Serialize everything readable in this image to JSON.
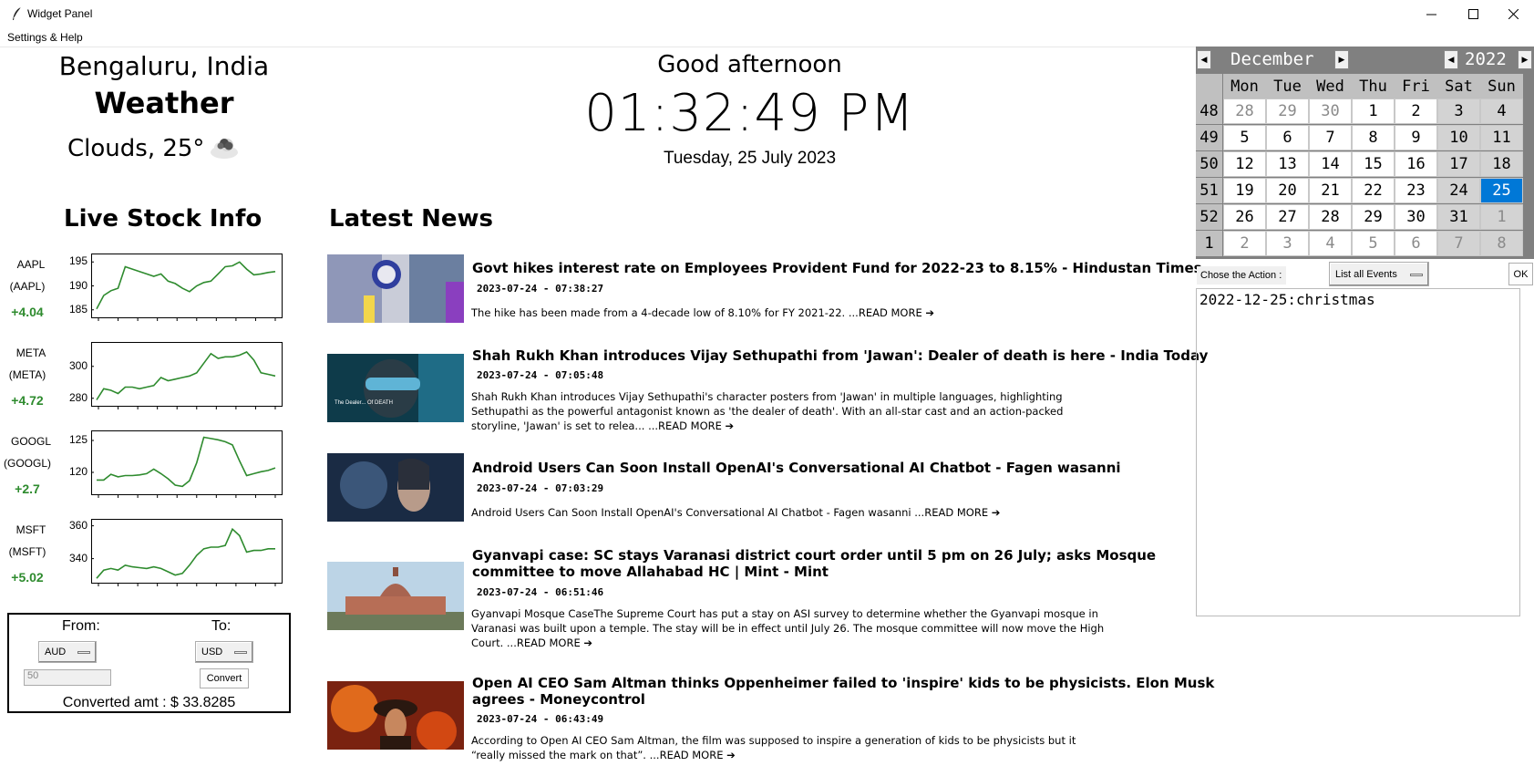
{
  "window": {
    "title": "Widget Panel",
    "controls": {
      "minimize": "minimize-icon",
      "maximize": "maximize-icon",
      "close": "close-icon"
    }
  },
  "menu": {
    "settings_help": "Settings & Help"
  },
  "weather": {
    "city": "Bengaluru, India",
    "title": "Weather",
    "condition": "Clouds, 25°",
    "icon": "cloud-icon"
  },
  "clock": {
    "greeting": "Good afternoon",
    "time": "01:32:49 PM",
    "date": "Tuesday, 25 July 2023"
  },
  "stocks": {
    "title": "Live Stock Info",
    "items": [
      {
        "symbol": "AAPL",
        "symbol2": "(AAPL)",
        "change": "+4.04",
        "ylim": [
          184,
          196
        ],
        "yticks": [
          "195",
          "190",
          "185"
        ],
        "ytick_values": [
          195,
          190,
          185
        ],
        "values": [
          185.2,
          188,
          189,
          189.5,
          194,
          193.5,
          193,
          192.5,
          192,
          192.5,
          191,
          190.5,
          189.5,
          188.8,
          190,
          190.7,
          191,
          192.5,
          194,
          194.2,
          195,
          193.5,
          192.3,
          192.5,
          192.8,
          193
        ]
      },
      {
        "symbol": "META",
        "symbol2": "(META)",
        "change": "+4.72",
        "ylim": [
          277,
          313
        ],
        "yticks": [
          "300",
          "280"
        ],
        "ytick_values": [
          300,
          280
        ],
        "values": [
          279,
          286,
          285,
          283,
          287,
          287,
          286,
          287,
          288,
          293,
          291,
          292,
          293,
          294,
          296,
          302,
          308,
          305,
          306,
          306,
          307,
          309,
          304,
          296,
          295,
          294
        ]
      },
      {
        "symbol": "GOOGL",
        "symbol2": "(GOOGL)",
        "change": "+2.7",
        "ylim": [
          117,
          126
        ],
        "yticks": [
          "125",
          "120"
        ],
        "ytick_values": [
          125,
          120
        ],
        "values": [
          118.8,
          118.8,
          119.7,
          119.3,
          119.5,
          119.5,
          119.6,
          119.8,
          120.5,
          119.8,
          119,
          118,
          117.8,
          118.7,
          121.5,
          125.5,
          125.3,
          125.1,
          124.8,
          124.3,
          121.8,
          119.5,
          119.8,
          120.1,
          120.3,
          120.7
        ]
      },
      {
        "symbol": "MSFT",
        "symbol2": "(MSFT)",
        "change": "+5.02",
        "ylim": [
          327,
          362
        ],
        "yticks": [
          "360",
          "340"
        ],
        "ytick_values": [
          360,
          340
        ],
        "values": [
          328,
          333,
          334,
          333,
          336,
          335,
          334.5,
          334,
          335,
          334,
          332,
          330,
          331,
          336,
          342,
          346,
          347,
          347,
          348,
          358,
          354,
          344,
          345,
          345,
          346,
          346
        ]
      }
    ]
  },
  "converter": {
    "from_label": "From:",
    "to_label": "To:",
    "from_currency": "AUD",
    "to_currency": "USD",
    "amount_placeholder": "50",
    "convert_label": "Convert",
    "result": "Converted amt : $ 33.8285"
  },
  "news": {
    "title": "Latest News",
    "read_more": "...READ MORE ➔",
    "items": [
      {
        "headline": "Govt hikes interest rate on Employees Provident Fund for 2022-23 to 8.15% - Hindustan Times",
        "time": "2023-07-24 - 07:38:27",
        "description": "The hike has been made from a 4-decade low of 8.10% for FY 2021-22.",
        "image": "epfo-office-photo"
      },
      {
        "headline": "Shah Rukh Khan introduces Vijay Sethupathi from 'Jawan': Dealer of death is here - India Today",
        "time": "2023-07-24 - 07:05:48",
        "description": "Shah Rukh Khan introduces Vijay Sethupathi's character posters from 'Jawan' in multiple languages, highlighting Sethupathi as the powerful antagonist known as 'the dealer of death'. With an all-star cast and an action-packed storyline, 'Jawan' is set to relea...",
        "image": "jawan-poster",
        "image_caption": "The Dealer... Of DEATH"
      },
      {
        "headline": "Android Users Can Soon Install OpenAI's Conversational AI Chatbot - Fagen wasanni",
        "time": "2023-07-24 - 07:03:29",
        "description": "Android Users Can Soon Install OpenAI's Conversational AI Chatbot - Fagen wasanni",
        "image": "ai-robot-face"
      },
      {
        "headline": "Gyanvapi case: SC stays Varanasi district court order until 5 pm on 26 July; asks Mosque committee to move Allahabad HC | Mint - Mint",
        "time": "2023-07-24 - 06:51:46",
        "description": "Gyanvapi Mosque CaseThe Supreme Court has put a stay on ASI survey to determine whether the Gyanvapi mosque in Varanasi was built upon a temple. The stay will be in effect until July 26. The mosque committee will now move the High Court.",
        "image": "supreme-court-building"
      },
      {
        "headline": "Open AI CEO Sam Altman thinks Oppenheimer failed to 'inspire' kids to be physicists. Elon Musk agrees - Moneycontrol",
        "time": "2023-07-24 - 06:43:49",
        "description": "According to Open AI CEO Sam Altman, the film was supposed to inspire a generation of kids to be physicists but it “really missed the mark on that”.",
        "image": "oppenheimer-poster"
      }
    ]
  },
  "calendar": {
    "month": "December",
    "year": "2022",
    "days_of_week": [
      "Mon",
      "Tue",
      "Wed",
      "Thu",
      "Fri",
      "Sat",
      "Sun"
    ],
    "selected": "25",
    "weeks": [
      {
        "num": "48",
        "days": [
          {
            "d": "28",
            "o": true
          },
          {
            "d": "29",
            "o": true
          },
          {
            "d": "30",
            "o": true
          },
          {
            "d": "1"
          },
          {
            "d": "2"
          },
          {
            "d": "3",
            "w": true
          },
          {
            "d": "4",
            "w": true
          }
        ]
      },
      {
        "num": "49",
        "days": [
          {
            "d": "5"
          },
          {
            "d": "6"
          },
          {
            "d": "7"
          },
          {
            "d": "8"
          },
          {
            "d": "9"
          },
          {
            "d": "10",
            "w": true
          },
          {
            "d": "11",
            "w": true
          }
        ]
      },
      {
        "num": "50",
        "days": [
          {
            "d": "12"
          },
          {
            "d": "13"
          },
          {
            "d": "14"
          },
          {
            "d": "15"
          },
          {
            "d": "16"
          },
          {
            "d": "17",
            "w": true
          },
          {
            "d": "18",
            "w": true
          }
        ]
      },
      {
        "num": "51",
        "days": [
          {
            "d": "19"
          },
          {
            "d": "20"
          },
          {
            "d": "21"
          },
          {
            "d": "22"
          },
          {
            "d": "23"
          },
          {
            "d": "24",
            "w": true
          },
          {
            "d": "25",
            "w": true,
            "sel": true
          }
        ]
      },
      {
        "num": "52",
        "days": [
          {
            "d": "26"
          },
          {
            "d": "27"
          },
          {
            "d": "28"
          },
          {
            "d": "29"
          },
          {
            "d": "30"
          },
          {
            "d": "31",
            "w": true
          },
          {
            "d": "1",
            "w": true,
            "o": true
          }
        ]
      },
      {
        "num": "1",
        "days": [
          {
            "d": "2",
            "o": true
          },
          {
            "d": "3",
            "o": true
          },
          {
            "d": "4",
            "o": true
          },
          {
            "d": "5",
            "o": true
          },
          {
            "d": "6",
            "o": true
          },
          {
            "d": "7",
            "w": true,
            "o": true
          },
          {
            "d": "8",
            "w": true,
            "o": true
          }
        ]
      }
    ]
  },
  "events": {
    "action_label": "Chose the Action :",
    "action_selected": "List all Events",
    "ok_label": "OK",
    "content": "2022-12-25:christmas"
  },
  "colors": {
    "stock_line": "#2e8b2e",
    "calendar_selected": "#0078d7",
    "calendar_header": "#808080"
  }
}
